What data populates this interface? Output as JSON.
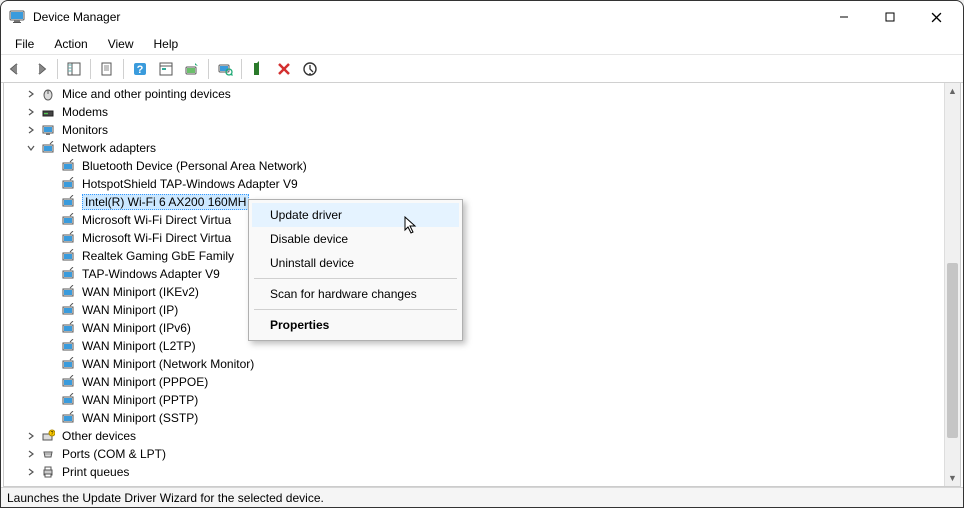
{
  "window": {
    "title": "Device Manager"
  },
  "menu": {
    "file": "File",
    "action": "Action",
    "view": "View",
    "help": "Help"
  },
  "tree": {
    "mice": "Mice and other pointing devices",
    "modems": "Modems",
    "monitors": "Monitors",
    "network_adapters": "Network adapters",
    "na": {
      "bluetooth": "Bluetooth Device (Personal Area Network)",
      "hotspot": "HotspotShield TAP-Windows Adapter V9",
      "intel": "Intel(R) Wi-Fi 6 AX200 160MH",
      "msvirt1": "Microsoft Wi-Fi Direct Virtua",
      "msvirt2": "Microsoft Wi-Fi Direct Virtua",
      "realtek": "Realtek Gaming GbE Family ",
      "tap": "TAP-Windows Adapter V9",
      "wan_ikev2": "WAN Miniport (IKEv2)",
      "wan_ip": "WAN Miniport (IP)",
      "wan_ipv6": "WAN Miniport (IPv6)",
      "wan_l2tp": "WAN Miniport (L2TP)",
      "wan_netmon": "WAN Miniport (Network Monitor)",
      "wan_pppoe": "WAN Miniport (PPPOE)",
      "wan_pptp": "WAN Miniport (PPTP)",
      "wan_sstp": "WAN Miniport (SSTP)"
    },
    "other": "Other devices",
    "ports": "Ports (COM & LPT)",
    "print": "Print queues"
  },
  "context_menu": {
    "update": "Update driver",
    "disable": "Disable device",
    "uninstall": "Uninstall device",
    "scan": "Scan for hardware changes",
    "properties": "Properties"
  },
  "statusbar": {
    "text": "Launches the Update Driver Wizard for the selected device."
  }
}
